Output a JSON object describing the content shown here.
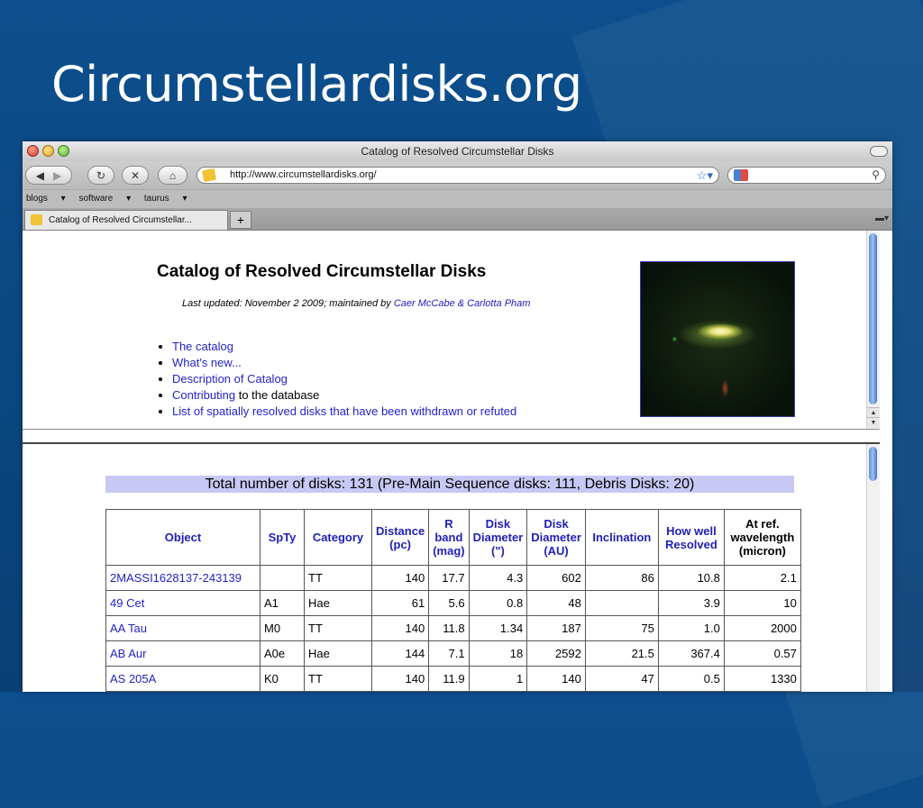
{
  "slide": {
    "title": "Circumstellardisks.org"
  },
  "browser": {
    "window_title": "Catalog of Resolved Circumstellar Disks",
    "url": "http://www.circumstellardisks.org/",
    "bookmarks": [
      "blogs",
      "software",
      "taurus"
    ],
    "tab_label": "Catalog of Resolved Circumstellar...",
    "newtab_label": "+"
  },
  "page": {
    "title": "Catalog of Resolved Circumstellar Disks",
    "updated_prefix": "Last updated: November 2 2009; maintained by ",
    "maintainers": "Caer McCabe & Carlotta Pham",
    "menu": [
      {
        "link": "The catalog",
        "suffix": ""
      },
      {
        "link": "What's new...",
        "suffix": ""
      },
      {
        "link": "Description of Catalog",
        "suffix": ""
      },
      {
        "link": "Contributing",
        "suffix": " to the database"
      },
      {
        "link": "List of spatially resolved disks that have been withdrawn or refuted",
        "suffix": ""
      }
    ],
    "total": "Total number of disks: 131 (Pre-Main Sequence disks: 111, Debris Disks: 20)",
    "table": {
      "headers": [
        "Object",
        "SpTy",
        "Category",
        "Distance (pc)",
        "R band (mag)",
        "Disk Diameter (\")",
        "Disk Diameter (AU)",
        "Inclination",
        "How well Resolved",
        "At ref. wavelength (micron)"
      ],
      "rows": [
        [
          "2MASSI1628137-243139",
          "",
          "TT",
          "140",
          "17.7",
          "4.3",
          "602",
          "86",
          "10.8",
          "2.1"
        ],
        [
          "49 Cet",
          "A1",
          "Hae",
          "61",
          "5.6",
          "0.8",
          "48",
          "",
          "3.9",
          "10"
        ],
        [
          "AA Tau",
          "M0",
          "TT",
          "140",
          "11.8",
          "1.34",
          "187",
          "75",
          "1.0",
          "2000"
        ],
        [
          "AB Aur",
          "A0e",
          "Hae",
          "144",
          "7.1",
          "18",
          "2592",
          "21.5",
          "367.4",
          "0.57"
        ],
        [
          "AS 205A",
          "K0",
          "TT",
          "140",
          "11.9",
          "1",
          "140",
          "47",
          "0.5",
          "1330"
        ]
      ]
    }
  }
}
